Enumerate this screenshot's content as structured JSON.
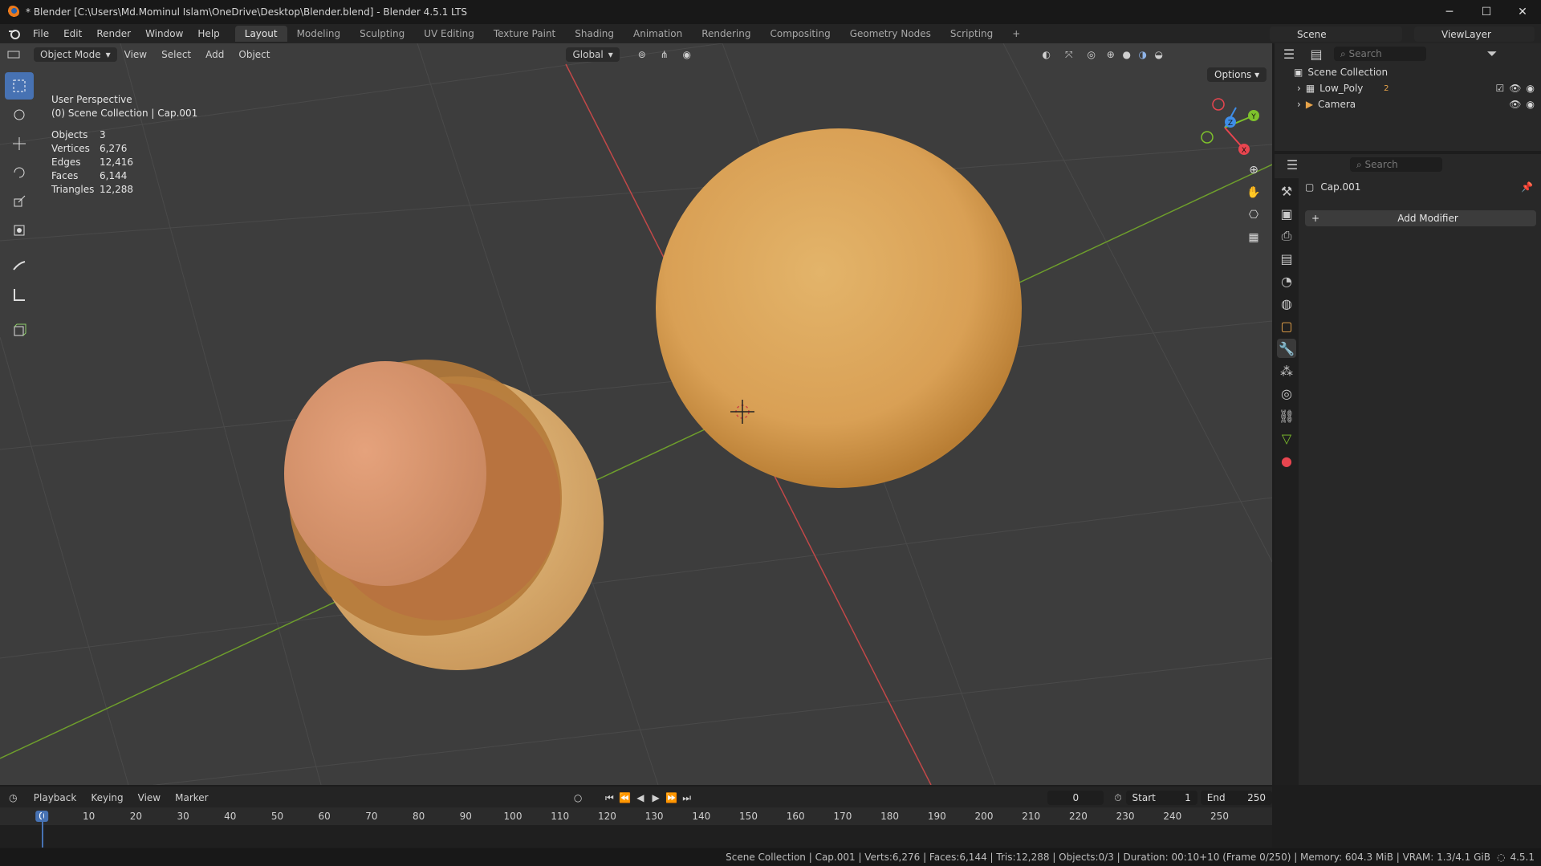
{
  "window": {
    "title": "* Blender [C:\\Users\\Md.Mominul Islam\\OneDrive\\Desktop\\Blender.blend] - Blender 4.5.1 LTS",
    "minimize": "─",
    "maximize": "☐",
    "close": "✕"
  },
  "menu": [
    "File",
    "Edit",
    "Render",
    "Window",
    "Help"
  ],
  "workspaces": [
    "Layout",
    "Modeling",
    "Sculpting",
    "UV Editing",
    "Texture Paint",
    "Shading",
    "Animation",
    "Rendering",
    "Compositing",
    "Geometry Nodes",
    "Scripting"
  ],
  "active_workspace": "Layout",
  "add_workspace": "+",
  "scene": {
    "label": "Scene",
    "view_layer": "ViewLayer"
  },
  "viewport_header": {
    "mode": "Object Mode",
    "menus": [
      "View",
      "Select",
      "Add",
      "Object"
    ],
    "orientation": "Global",
    "options": "Options"
  },
  "overlay": {
    "view": "User Perspective",
    "collection": "(0) Scene Collection | Cap.001",
    "stats": [
      {
        "key": "Objects",
        "value": "3"
      },
      {
        "key": "Vertices",
        "value": "6,276"
      },
      {
        "key": "Edges",
        "value": "12,416"
      },
      {
        "key": "Faces",
        "value": "6,144"
      },
      {
        "key": "Triangles",
        "value": "12,288"
      }
    ]
  },
  "gizmo": {
    "x": "X",
    "y": "Y",
    "z": "Z"
  },
  "outliner": {
    "search_placeholder": "Search",
    "root": "Scene Collection",
    "items": [
      {
        "name": "Low_Poly",
        "badge": "2"
      },
      {
        "name": "Camera"
      }
    ]
  },
  "properties": {
    "search_placeholder": "Search",
    "object": "Cap.001",
    "add_modifier": "Add Modifier"
  },
  "timeline": {
    "menus": [
      "Playback",
      "Keying",
      "View",
      "Marker"
    ],
    "current_frame": "0",
    "start_label": "Start",
    "start": "1",
    "end_label": "End",
    "end": "250",
    "ticks": [
      "0",
      "10",
      "20",
      "30",
      "40",
      "50",
      "60",
      "70",
      "80",
      "90",
      "100",
      "110",
      "120",
      "130",
      "140",
      "150",
      "160",
      "170",
      "180",
      "190",
      "200",
      "210",
      "220",
      "230",
      "240",
      "250"
    ]
  },
  "statusbar": {
    "text": "Scene Collection | Cap.001 | Verts:6,276 | Faces:6,144 | Tris:12,288 | Objects:0/3 | Duration: 00:10+10 (Frame 0/250) | Memory: 604.3 MiB | VRAM: 1.3/4.1 GiB",
    "version": "4.5.1"
  },
  "colors": {
    "accent": "#4772b3",
    "x_axis": "#e8454f",
    "y_axis": "#7ec12c",
    "z_axis": "#3f8ee8",
    "bg": "#3d3d3d"
  },
  "icons": [
    "blender-logo",
    "select-box-icon",
    "cursor-icon",
    "move-icon",
    "rotate-icon",
    "scale-icon",
    "transform-icon",
    "annotate-icon",
    "measure-icon",
    "add-cube-icon",
    "zoom-icon",
    "pan-hand-icon",
    "camera-view-icon",
    "grid-view-icon",
    "eye-icon",
    "camera-render-icon",
    "wrench-icon",
    "filter-icon"
  ]
}
